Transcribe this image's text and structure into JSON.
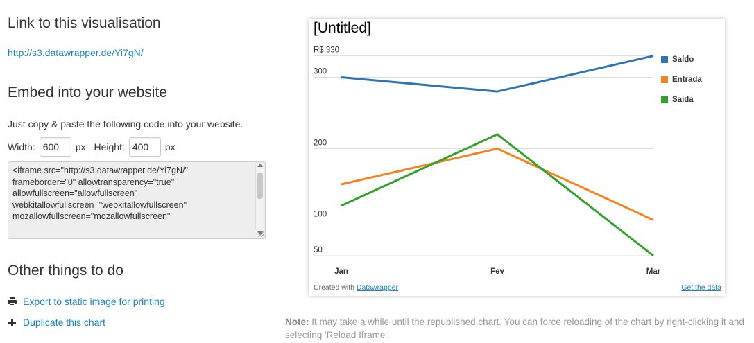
{
  "link_section": {
    "heading": "Link to this visualisation",
    "url": "http://s3.datawrapper.de/Yi7gN/"
  },
  "embed_section": {
    "heading": "Embed into your website",
    "intro": "Just copy & paste the following code into your website.",
    "width_label": "Width:",
    "width_value": "600",
    "width_unit": "px",
    "height_label": "Height:",
    "height_value": "400",
    "height_unit": "px",
    "code_lines": [
      "<iframe src=\"http://s3.datawrapper.de/Yi7gN/\"",
      "frameborder=\"0\" allowtransparency=\"true\"",
      "allowfullscreen=\"allowfullscreen\"",
      "webkitallowfullscreen=\"webkitallowfullscreen\"",
      "mozallowfullscreen=\"mozallowfullscreen\""
    ]
  },
  "other_section": {
    "heading": "Other things to do",
    "export_label": "Export to static image for printing",
    "duplicate_label": "Duplicate this chart"
  },
  "chart_frame": {
    "footer_created": "Created with",
    "footer_brand": "Datawrapper",
    "footer_get_data": "Get the data"
  },
  "note": {
    "label": "Note:",
    "text": "It may take a while until the republished chart. You can force reloading of the chart by right-clicking it and selecting 'Reload Iframe'."
  },
  "chart_data": {
    "type": "line",
    "title": "[Untitled]",
    "categories": [
      "Jan",
      "Fev",
      "Mar"
    ],
    "y_ticks": [
      {
        "value": 330,
        "label": "R$ 330"
      },
      {
        "value": 300,
        "label": "300"
      },
      {
        "value": 200,
        "label": "200"
      },
      {
        "value": 100,
        "label": "100"
      },
      {
        "value": 50,
        "label": "50"
      }
    ],
    "ylim": [
      50,
      330
    ],
    "series": [
      {
        "name": "Saldo",
        "color": "#2e75b6",
        "values": [
          300,
          280,
          330
        ]
      },
      {
        "name": "Entrada",
        "color": "#f58220",
        "values": [
          150,
          200,
          100
        ]
      },
      {
        "name": "Saída",
        "color": "#33a02c",
        "values": [
          120,
          220,
          50
        ]
      }
    ],
    "legend_position": "right",
    "grid": true
  }
}
